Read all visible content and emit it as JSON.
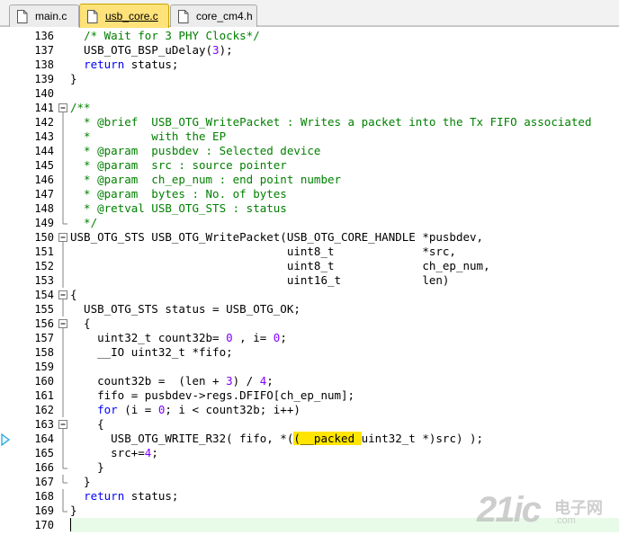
{
  "tabs": [
    {
      "label": "main.c",
      "active": false
    },
    {
      "label": "usb_core.c",
      "active": true
    },
    {
      "label": "core_cm4.h",
      "active": false
    }
  ],
  "editor": {
    "current_line": 170,
    "exec_line": 164,
    "lines": [
      {
        "n": "136",
        "fold": "",
        "segs": [
          [
            "  ",
            ""
          ],
          [
            "/* Wait for 3 PHY Clocks*/",
            "cm"
          ]
        ]
      },
      {
        "n": "137",
        "fold": "",
        "segs": [
          [
            "  USB_OTG_BSP_uDelay(",
            ""
          ],
          [
            "3",
            "num"
          ],
          [
            ");",
            ""
          ]
        ]
      },
      {
        "n": "138",
        "fold": "",
        "segs": [
          [
            "  ",
            ""
          ],
          [
            "return",
            "kw"
          ],
          [
            " status;",
            ""
          ]
        ]
      },
      {
        "n": "139",
        "fold": "",
        "segs": [
          [
            "}",
            ""
          ]
        ]
      },
      {
        "n": "140",
        "fold": "",
        "segs": []
      },
      {
        "n": "141",
        "fold": "open",
        "segs": [
          [
            "/**",
            "cm"
          ]
        ]
      },
      {
        "n": "142",
        "fold": "",
        "segs": [
          [
            "  * @brief  USB_OTG_WritePacket : Writes a packet into the Tx FIFO associated",
            "cm"
          ]
        ]
      },
      {
        "n": "143",
        "fold": "",
        "segs": [
          [
            "  *         with the EP",
            "cm"
          ]
        ]
      },
      {
        "n": "144",
        "fold": "",
        "segs": [
          [
            "  * @param  pusbdev : Selected device",
            "cm"
          ]
        ]
      },
      {
        "n": "145",
        "fold": "",
        "segs": [
          [
            "  * @param  src : source pointer",
            "cm"
          ]
        ]
      },
      {
        "n": "146",
        "fold": "",
        "segs": [
          [
            "  * @param  ch_ep_num : end point number",
            "cm"
          ]
        ]
      },
      {
        "n": "147",
        "fold": "",
        "segs": [
          [
            "  * @param  bytes : No. of bytes",
            "cm"
          ]
        ]
      },
      {
        "n": "148",
        "fold": "",
        "segs": [
          [
            "  * @retval USB_OTG_STS : status",
            "cm"
          ]
        ]
      },
      {
        "n": "149",
        "fold": "end",
        "segs": [
          [
            "  */",
            "cm"
          ]
        ]
      },
      {
        "n": "150",
        "fold": "open",
        "segs": [
          [
            "USB_OTG_STS USB_OTG_WritePacket(USB_OTG_CORE_HANDLE *pusbdev,",
            ""
          ]
        ]
      },
      {
        "n": "151",
        "fold": "",
        "segs": [
          [
            "                                uint8_t             *src,",
            ""
          ]
        ]
      },
      {
        "n": "152",
        "fold": "",
        "segs": [
          [
            "                                uint8_t             ch_ep_num,",
            ""
          ]
        ]
      },
      {
        "n": "153",
        "fold": "",
        "segs": [
          [
            "                                uint16_t            len)",
            ""
          ]
        ]
      },
      {
        "n": "154",
        "fold": "open",
        "segs": [
          [
            "{",
            ""
          ]
        ]
      },
      {
        "n": "155",
        "fold": "",
        "segs": [
          [
            "  USB_OTG_STS status = USB_OTG_OK;",
            ""
          ]
        ]
      },
      {
        "n": "156",
        "fold": "open",
        "segs": [
          [
            "  {",
            ""
          ]
        ]
      },
      {
        "n": "157",
        "fold": "",
        "segs": [
          [
            "    uint32_t count32b= ",
            ""
          ],
          [
            "0",
            "num"
          ],
          [
            " , i= ",
            ""
          ],
          [
            "0",
            "num"
          ],
          [
            ";",
            ""
          ]
        ]
      },
      {
        "n": "158",
        "fold": "",
        "segs": [
          [
            "    __IO uint32_t *fifo;",
            ""
          ]
        ]
      },
      {
        "n": "159",
        "fold": "",
        "segs": []
      },
      {
        "n": "160",
        "fold": "",
        "segs": [
          [
            "    count32b =  (len + ",
            ""
          ],
          [
            "3",
            "num"
          ],
          [
            ") / ",
            ""
          ],
          [
            "4",
            "num"
          ],
          [
            ";",
            ""
          ]
        ]
      },
      {
        "n": "161",
        "fold": "",
        "segs": [
          [
            "    fifo = pusbdev->regs.DFIFO[ch_ep_num];",
            ""
          ]
        ]
      },
      {
        "n": "162",
        "fold": "",
        "segs": [
          [
            "    ",
            ""
          ],
          [
            "for",
            "kw"
          ],
          [
            " (i = ",
            ""
          ],
          [
            "0",
            "num"
          ],
          [
            "; i < count32b; i++)",
            ""
          ]
        ]
      },
      {
        "n": "163",
        "fold": "open",
        "segs": [
          [
            "    {",
            ""
          ]
        ]
      },
      {
        "n": "164",
        "fold": "",
        "segs": [
          [
            "      USB_OTG_WRITE_R32( fifo, *(",
            ""
          ],
          [
            "(__packed ",
            "hl"
          ],
          [
            "uint32_t *)src) );",
            ""
          ]
        ]
      },
      {
        "n": "165",
        "fold": "",
        "segs": [
          [
            "      src+=",
            ""
          ],
          [
            "4",
            "num"
          ],
          [
            ";",
            ""
          ]
        ]
      },
      {
        "n": "166",
        "fold": "end",
        "segs": [
          [
            "    }",
            ""
          ]
        ]
      },
      {
        "n": "167",
        "fold": "end",
        "segs": [
          [
            "  }",
            ""
          ]
        ]
      },
      {
        "n": "168",
        "fold": "",
        "segs": [
          [
            "  ",
            ""
          ],
          [
            "return",
            "kw"
          ],
          [
            " status;",
            ""
          ]
        ]
      },
      {
        "n": "169",
        "fold": "end",
        "segs": [
          [
            "}",
            ""
          ]
        ]
      },
      {
        "n": "170",
        "fold": "",
        "segs": []
      }
    ]
  },
  "watermark": {
    "big": "21ic",
    "cn": "电子网",
    "url": ".com"
  },
  "colors": {
    "keyword": "#0000ff",
    "comment": "#008000",
    "number": "#8000ff",
    "highlight": "#ffe500",
    "active_tab": "#ffe27a"
  }
}
